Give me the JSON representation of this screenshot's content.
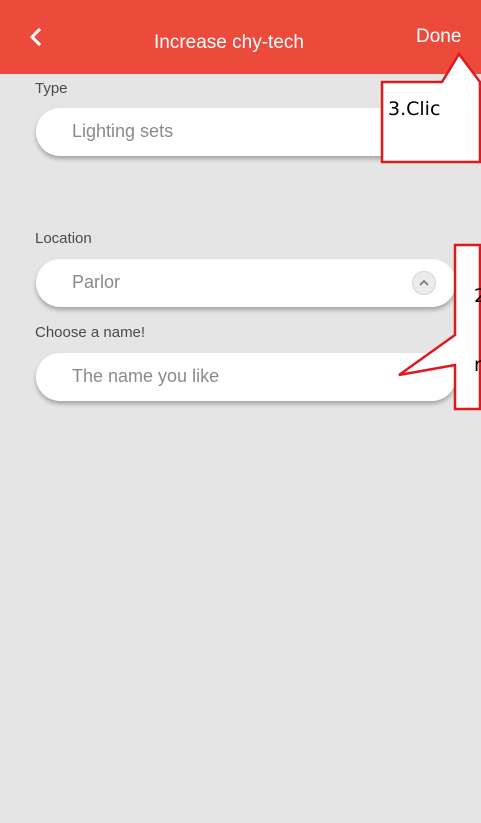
{
  "header": {
    "back_icon": "chevron-left-icon",
    "title": "Increase chy-tech",
    "done_label": "Done"
  },
  "form": {
    "type_label": "Type",
    "type_value": "Lighting sets",
    "location_label": "Location",
    "location_value": "Parlor",
    "location_toggle_icon": "chevron-up-icon",
    "name_label": "Choose a name!",
    "name_placeholder": "The name you like"
  },
  "annotations": {
    "step3_text": "3.Clic",
    "step2_line1": "2",
    "step2_line2": "r"
  },
  "colors": {
    "header_bg": "#ec4b3c",
    "page_bg": "#e5e5e5",
    "callout_border": "#e0191f"
  }
}
